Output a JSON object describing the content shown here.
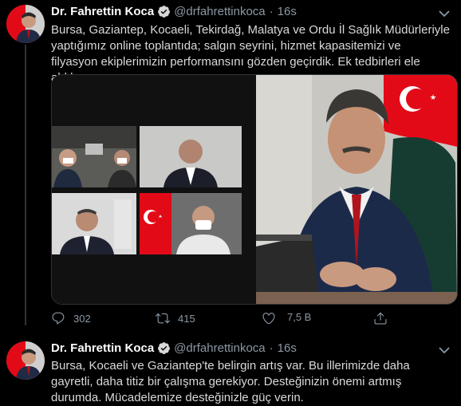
{
  "tweets": [
    {
      "author_name": "Dr. Fahrettin Koca",
      "handle": "@drfahrettinkoca",
      "separator": "·",
      "time": "16s",
      "text": "Bursa, Gaziantep, Kocaeli, Tekirdağ, Malatya ve Ordu İl Sağlık Müdürleriyle yaptığımız online toplantıda; salgın seyrini, hizmet kapasitemizi ve filyasyon ekiplerimizin performansını gözden geçirdik. Ek tedbirleri ele aldık.",
      "actions": {
        "replies": "302",
        "retweets": "415",
        "likes": "",
        "views": "7,5 B"
      }
    },
    {
      "author_name": "Dr. Fahrettin Koca",
      "handle": "@drfahrettinkoca",
      "separator": "·",
      "time": "16s",
      "text": "Bursa, Kocaeli ve Gaziantep'te belirgin artış var. Bu illerimizde daha gayretli, daha titiz bir çalışma gerekiyor. Desteğinizin önemi artmış durumda. Mücadelemize desteğinizle güç verin."
    }
  ],
  "colors": {
    "background": "#000000",
    "text": "#d9d9d9",
    "secondary": "#8b98a5",
    "verified": "#d9d9d9",
    "flag_red": "#e30a17"
  },
  "icons": [
    "verified-badge-icon",
    "caret-down-icon",
    "reply-icon",
    "retweet-icon",
    "like-icon",
    "views-icon",
    "share-icon"
  ]
}
